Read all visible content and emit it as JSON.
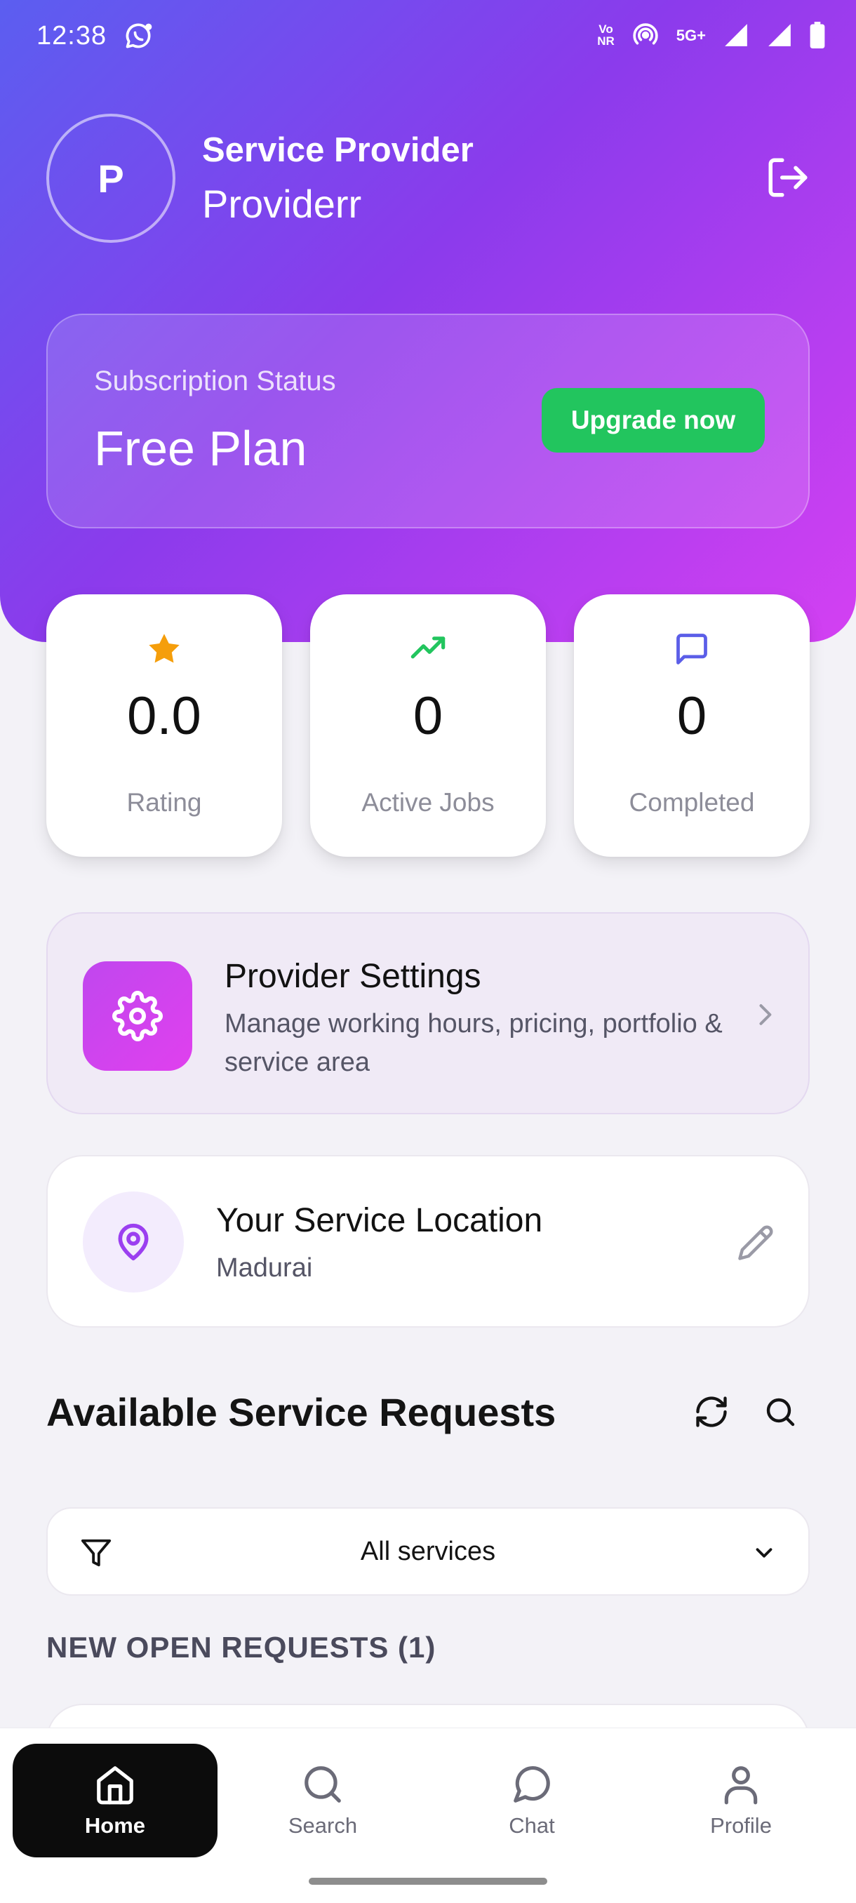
{
  "status_bar": {
    "time": "12:38",
    "volte_top": "Vo",
    "volte_bottom": "NR",
    "network": "5G+"
  },
  "header": {
    "avatar_initial": "P",
    "role": "Service Provider",
    "username": "Providerr"
  },
  "subscription": {
    "label": "Subscription Status",
    "plan": "Free Plan",
    "upgrade_label": "Upgrade now"
  },
  "stats": [
    {
      "icon": "star-icon",
      "value": "0.0",
      "label": "Rating",
      "color": "#f59e0b"
    },
    {
      "icon": "trending-up-icon",
      "value": "0",
      "label": "Active Jobs",
      "color": "#22c55e"
    },
    {
      "icon": "message-square-icon",
      "value": "0",
      "label": "Completed",
      "color": "#5b5ee8"
    }
  ],
  "provider_settings": {
    "title": "Provider Settings",
    "description": "Manage working hours, pricing, portfolio & service area"
  },
  "location": {
    "title": "Your Service Location",
    "city": "Madurai"
  },
  "requests": {
    "title": "Available Service Requests",
    "filter_value": "All services",
    "open_label": "NEW OPEN REQUESTS (1)"
  },
  "nav": [
    {
      "label": "Home",
      "icon": "home-icon",
      "active": true
    },
    {
      "label": "Search",
      "icon": "search-icon",
      "active": false
    },
    {
      "label": "Chat",
      "icon": "chat-icon",
      "active": false
    },
    {
      "label": "Profile",
      "icon": "profile-icon",
      "active": false
    }
  ],
  "colors": {
    "gradient_start": "#5b5ef0",
    "gradient_mid": "#8b3bec",
    "gradient_end": "#d440f2",
    "accent_green": "#22c55e",
    "accent_purple": "#9b3ff0"
  }
}
